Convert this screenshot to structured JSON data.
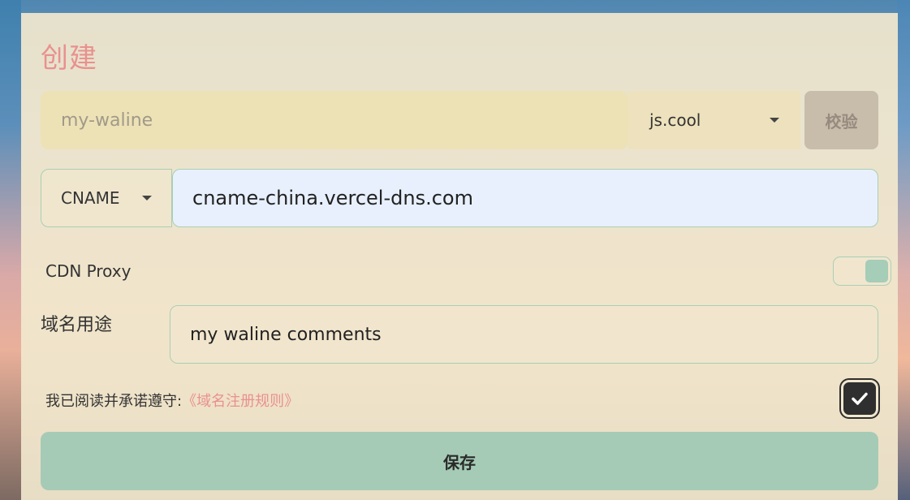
{
  "form": {
    "title": "创建",
    "subdomain": {
      "placeholder": "my-waline"
    },
    "domain_select": {
      "selected": "js.cool"
    },
    "verify_button": "校验",
    "record_type": {
      "selected": "CNAME"
    },
    "record_value": "cname-china.vercel-dns.com",
    "cdn_proxy": {
      "label": "CDN Proxy",
      "enabled": true
    },
    "purpose": {
      "label": "域名用途",
      "value": "my waline comments"
    },
    "agreement": {
      "text": "我已阅读并承诺遵守:",
      "link": "《域名注册规则》",
      "checked": true
    },
    "save_button": "保存"
  },
  "colors": {
    "accent": "#e9918f",
    "primary_button": "#a5cbb6",
    "border_green": "#a9cfb4"
  }
}
